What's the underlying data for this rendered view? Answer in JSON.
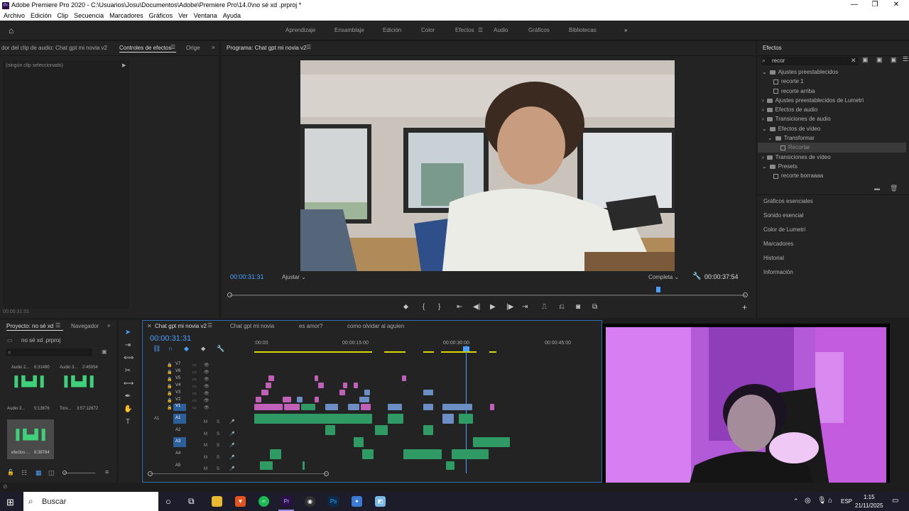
{
  "window": {
    "title": "Adobe Premiere Pro 2020 - C:\\Usuarios\\Josu\\Documentos\\Adobe\\Premiere Pro\\14.0\\no sé xd .prproj *"
  },
  "menu": [
    "Archivo",
    "Edición",
    "Clip",
    "Secuencia",
    "Marcadores",
    "Gráficos",
    "Ver",
    "Ventana",
    "Ayuda"
  ],
  "workspaces": {
    "items": [
      "Aprendizaje",
      "Ensamblaje",
      "Edición",
      "Color",
      "Efectos",
      "Audio",
      "Gráficos",
      "Bibliotecas"
    ],
    "active": "Efectos"
  },
  "source_panel": {
    "tab1": "dor del clip de audio: Chat gpt mi novia v2",
    "tab2": "Controles de efectos",
    "tab3": "Orige",
    "empty": "(ningún clip seleccionado)",
    "timecode": "00:00:31:31"
  },
  "program": {
    "tab": "Programa: Chat gpt mi novia v2",
    "timecode": "00:00:31:31",
    "fit": "Ajustar",
    "quality": "Completa",
    "duration": "00:00:37:54"
  },
  "effects": {
    "title": "Efectos",
    "search": "recor",
    "tree": [
      {
        "label": "Ajustes preestablecidos",
        "type": "folder",
        "level": 0,
        "open": true
      },
      {
        "label": "recorte 1",
        "type": "fx",
        "level": 1
      },
      {
        "label": "recorte arriba",
        "type": "fx",
        "level": 1
      },
      {
        "label": "Ajustes preestablecidos de Lumetri",
        "type": "folder",
        "level": 0
      },
      {
        "label": "Efectos de audio",
        "type": "folder",
        "level": 0
      },
      {
        "label": "Transiciones de audio",
        "type": "folder",
        "level": 0
      },
      {
        "label": "Efectos de vídeo",
        "type": "folder",
        "level": 0,
        "open": true
      },
      {
        "label": "Transformar",
        "type": "folder",
        "level": 1,
        "open": true
      },
      {
        "label": "Recortar",
        "type": "fx",
        "level": 2,
        "selected": true
      },
      {
        "label": "Transiciones de vídeo",
        "type": "folder",
        "level": 0
      },
      {
        "label": "Presets",
        "type": "folder",
        "level": 0,
        "open": true
      },
      {
        "label": "recorte borraaaa",
        "type": "fx",
        "level": 1
      }
    ],
    "sections": [
      "Gráficos esenciales",
      "Sonido esencial",
      "Color de Lumetri",
      "Marcadores",
      "Historial",
      "Información"
    ]
  },
  "project": {
    "tab": "Proyecto: no sé xd",
    "tab2": "Navegador",
    "file": "no sé xd .prproj",
    "items": [
      {
        "name": "Audio 2...",
        "dur": "6:31490"
      },
      {
        "name": "Audio 3...",
        "dur": "2:45934"
      },
      {
        "name": "Audio 3...",
        "dur": "5:13676"
      },
      {
        "name": "Toni...",
        "dur": "3:57:12672"
      },
      {
        "name": "efectos ...",
        "dur": "8:38784"
      }
    ]
  },
  "timeline": {
    "tabs": [
      "Chat gpt mi novia v2",
      "Chat gpt mi novia",
      "es amor?",
      "como olvidar al aguien"
    ],
    "active": "Chat gpt mi novia v2",
    "timecode": "00:00:31:31",
    "ruler": [
      ":00:00",
      "00:00:15:00",
      "00:00:30:00",
      "00:00:45:00"
    ],
    "video_tracks": [
      "V7",
      "V6",
      "V5",
      "V4",
      "V3",
      "V2",
      "V1"
    ],
    "audio_tracks": [
      "A1",
      "A2",
      "A3",
      "A4",
      "A5"
    ]
  },
  "taskbar": {
    "search": "Buscar",
    "lang": "ESP",
    "time": "1:15",
    "date": "21/11/2025"
  }
}
